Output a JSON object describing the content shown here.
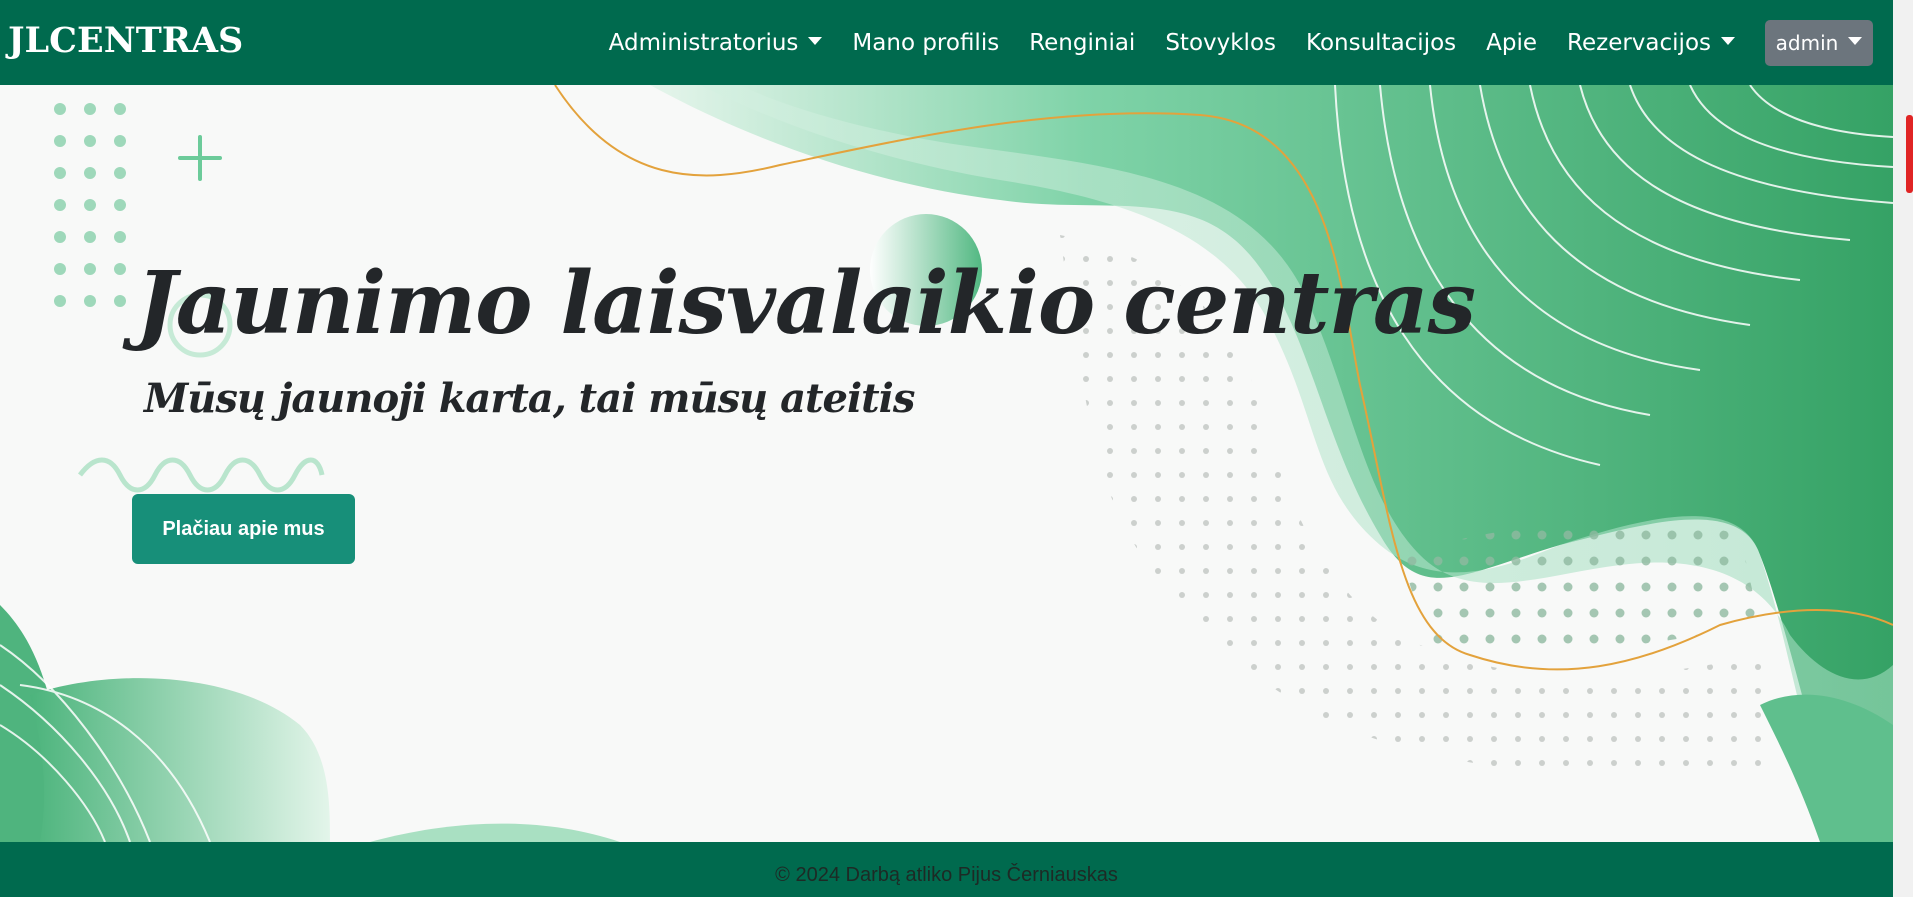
{
  "navbar": {
    "brand": "JLCENTRAS",
    "items": [
      {
        "label": "Administratorius",
        "dropdown": true
      },
      {
        "label": "Mano profilis"
      },
      {
        "label": "Renginiai"
      },
      {
        "label": "Stovyklos"
      },
      {
        "label": "Konsultacijos"
      },
      {
        "label": "Apie"
      },
      {
        "label": "Rezervacijos",
        "dropdown": true
      }
    ],
    "user_menu": "admin"
  },
  "hero": {
    "title": "Jaunimo laisvalaikio centras",
    "subtitle": "Mūsų jaunoji karta, tai mūsų ateitis",
    "cta_label": "Plačiau apie mus"
  },
  "footer": {
    "text": "© 2024 Darbą atliko Pijus Černiauskas"
  },
  "colors": {
    "navbar": "#006a4e",
    "cta": "#178f79",
    "user_menu": "#6c757d",
    "accent_green": "#3fa86d"
  }
}
